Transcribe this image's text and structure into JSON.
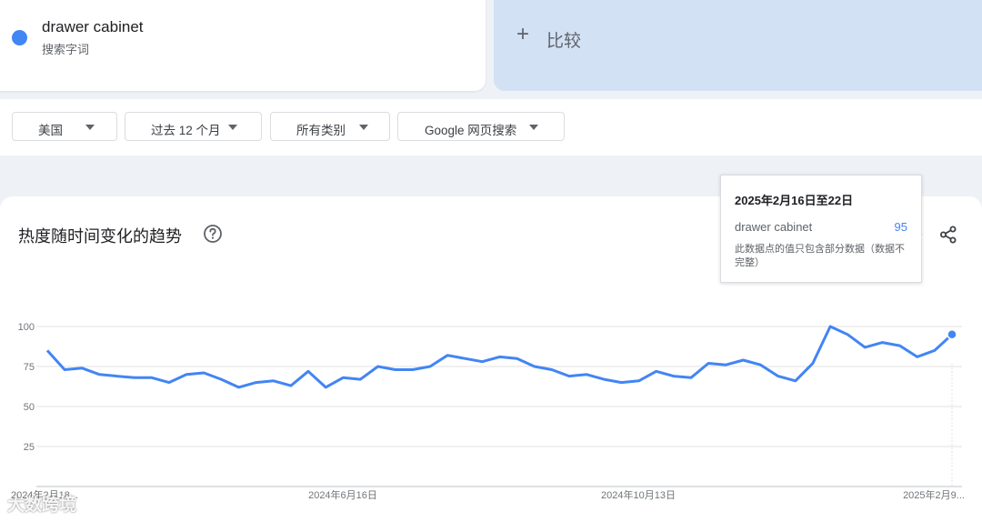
{
  "search_term": {
    "name": "drawer cabinet",
    "type": "搜索字词",
    "color": "#4285f4"
  },
  "compare": {
    "label": "比较"
  },
  "filters": [
    {
      "label": "美国"
    },
    {
      "label": "过去 12 个月"
    },
    {
      "label": "所有类别"
    },
    {
      "label": "Google 网页搜索"
    }
  ],
  "chart_section": {
    "title": "热度随时间变化的趋势",
    "icons": [
      "help-icon",
      "download-icon",
      "embed-icon",
      "share-icon"
    ]
  },
  "tooltip": {
    "date": "2025年2月16日至22日",
    "term": "drawer cabinet",
    "value": "95",
    "note": "此数据点的值只包含部分数据（数据不完整）"
  },
  "watermark": "大数跨境",
  "chart_data": {
    "type": "line",
    "title": "热度随时间变化的趋势",
    "xlabel": "",
    "ylabel": "",
    "ylim": [
      0,
      100
    ],
    "y_ticks": [
      25,
      50,
      75,
      100
    ],
    "x_tick_labels": [
      "2024年2月18...",
      "2024年6月16日",
      "2024年10月13日",
      "2025年2月9..."
    ],
    "grid": true,
    "series": [
      {
        "name": "drawer cabinet",
        "color": "#4285f4",
        "values": [
          85,
          73,
          74,
          70,
          69,
          68,
          68,
          65,
          70,
          71,
          67,
          62,
          65,
          66,
          63,
          72,
          62,
          68,
          67,
          75,
          73,
          73,
          75,
          82,
          80,
          78,
          81,
          80,
          75,
          73,
          69,
          70,
          67,
          65,
          66,
          72,
          69,
          68,
          77,
          76,
          79,
          76,
          69,
          66,
          77,
          100,
          95,
          87,
          90,
          88,
          81,
          85,
          95
        ]
      }
    ]
  }
}
